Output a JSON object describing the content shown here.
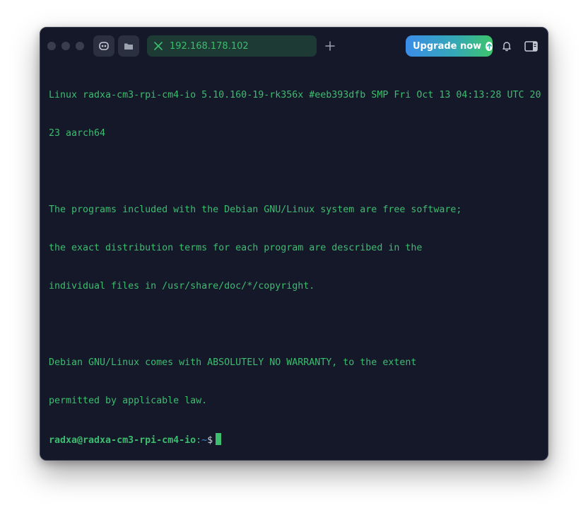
{
  "titlebar": {
    "tab": {
      "label": "192.168.178.102",
      "close_icon": "x-icon"
    },
    "new_tab_icon": "plus-icon",
    "upgrade": {
      "label": "Upgrade now",
      "icon": "arrow-up-circle-icon"
    },
    "notifications_icon": "bell-icon",
    "panel_icon": "sidebar-panel-icon",
    "left_buttons": [
      "ai-assistant-icon",
      "folder-icon"
    ]
  },
  "terminal": {
    "lines": [
      "Linux radxa-cm3-rpi-cm4-io 5.10.160-19-rk356x #eeb393dfb SMP Fri Oct 13 04:13:28 UTC 20",
      "23 aarch64",
      "",
      "The programs included with the Debian GNU/Linux system are free software;",
      "the exact distribution terms for each program are described in the",
      "individual files in /usr/share/doc/*/copyright.",
      "",
      "Debian GNU/Linux comes with ABSOLUTELY NO WARRANTY, to the extent",
      "permitted by applicable law."
    ],
    "prompt": {
      "user_host": "radxa@radxa-cm3-rpi-cm4-io",
      "separator": ":",
      "path": "~",
      "symbol": "$"
    }
  },
  "colors": {
    "background": "#141829",
    "terminal_text": "#3dbd6e",
    "tab_background": "#1d3a35",
    "upgrade_gradient_start": "#3b8de8",
    "upgrade_gradient_end": "#3cc56b"
  }
}
